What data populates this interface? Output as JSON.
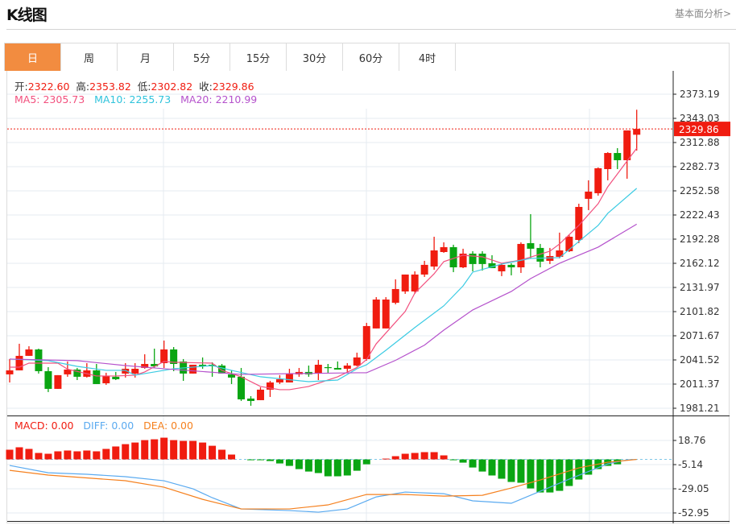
{
  "header": {
    "title": "K线图",
    "more_link": "基本面分析>"
  },
  "tabs": [
    {
      "label": "日",
      "active": true
    },
    {
      "label": "周",
      "active": false
    },
    {
      "label": "月",
      "active": false
    },
    {
      "label": "5分",
      "active": false
    },
    {
      "label": "15分",
      "active": false
    },
    {
      "label": "30分",
      "active": false
    },
    {
      "label": "60分",
      "active": false
    },
    {
      "label": "4时",
      "active": false
    }
  ],
  "ohlc_legend": {
    "open_label": "开:",
    "open": "2322.60",
    "high_label": "高:",
    "high": "2353.82",
    "low_label": "低:",
    "low": "2302.82",
    "close_label": "收:",
    "close": "2329.86"
  },
  "ma_legend": {
    "ma5": "MA5: 2305.73",
    "ma10": "MA10: 2255.73",
    "ma20": "MA20: 2210.99"
  },
  "macd_legend": {
    "macd": "MACD: 0.00",
    "diff": "DIFF: 0.00",
    "dea": "DEA: 0.00"
  },
  "colors": {
    "up": "#f01c10",
    "down": "#0aa512",
    "ma5": "#f2507e",
    "ma10": "#3ccbe3",
    "ma20": "#b552cc",
    "diff": "#5aaaf0",
    "dea": "#f5801e",
    "accent_tab": "#f28c40"
  },
  "chart_data": [
    {
      "type": "candlestick",
      "title": "",
      "ylim": [
        1981.21,
        2373.19
      ],
      "y_ticks": [
        "2373.19",
        "2343.03",
        "2312.88",
        "2282.73",
        "2252.58",
        "2222.43",
        "2192.28",
        "2162.12",
        "2131.97",
        "2101.82",
        "2071.67",
        "2041.52",
        "2011.37",
        "1981.21"
      ],
      "last_price_label": "2329.86",
      "last_price": 2329.86,
      "grid": true,
      "candles_ohlc": [
        [
          2023.5,
          2042.6,
          2013.4,
          2028.5
        ],
        [
          2028.5,
          2061.7,
          2028.5,
          2046.6
        ],
        [
          2046.6,
          2058.6,
          2046.6,
          2054.6
        ],
        [
          2054.6,
          2055.6,
          2024.5,
          2027.5
        ],
        [
          2027.5,
          2032.5,
          2001.4,
          2005.4
        ],
        [
          2005.4,
          2022.5,
          2005.4,
          2022.5
        ],
        [
          2023.5,
          2039.6,
          2020.5,
          2029.5
        ],
        [
          2029.5,
          2031.5,
          2016.4,
          2020.5
        ],
        [
          2020.5,
          2037.5,
          2019.5,
          2028.5
        ],
        [
          2028.5,
          2036.5,
          2011.4,
          2011.4
        ],
        [
          2012.4,
          2025.5,
          2010.4,
          2021.5
        ],
        [
          2020.5,
          2026.5,
          2016.4,
          2017.4
        ],
        [
          2024.5,
          2037.5,
          2019.5,
          2030.5
        ],
        [
          2024.5,
          2037.5,
          2019.5,
          2030.5
        ],
        [
          2031.5,
          2048.6,
          2030.5,
          2036.5
        ],
        [
          2036.5,
          2055.6,
          2031.5,
          2033.5
        ],
        [
          2037.5,
          2065.7,
          2031.5,
          2054.6
        ],
        [
          2054.6,
          2057.6,
          2027.5,
          2036.5
        ],
        [
          2039.6,
          2042.6,
          2015.4,
          2024.5
        ],
        [
          2024.5,
          2035.5,
          2024.5,
          2035.5
        ],
        [
          2035.5,
          2044.6,
          2030.5,
          2033.5
        ],
        [
          2035.5,
          2038.6,
          2020.5,
          2033.5
        ],
        [
          2034.5,
          2036.5,
          2024.5,
          2024.5
        ],
        [
          2023.5,
          2028.5,
          2011.4,
          2019.5
        ],
        [
          2020.5,
          2031.5,
          1990.3,
          1992.3
        ],
        [
          1993.3,
          1996.3,
          1984.3,
          1990.3
        ],
        [
          1991.3,
          2007.4,
          1991.3,
          2004.4
        ],
        [
          2004.4,
          2015.4,
          1995.3,
          2013.4
        ],
        [
          2013.4,
          2022.5,
          2011.4,
          2017.4
        ],
        [
          2013.4,
          2030.5,
          2013.4,
          2024.5
        ],
        [
          2023.5,
          2031.5,
          2020.5,
          2026.5
        ],
        [
          2026.5,
          2034.5,
          2020.5,
          2023.5
        ],
        [
          2024.5,
          2041.6,
          2016.4,
          2035.5
        ],
        [
          2032.5,
          2036.5,
          2025.5,
          2031.5
        ],
        [
          2031.5,
          2039.6,
          2029.5,
          2029.5
        ],
        [
          2030.5,
          2037.5,
          2025.5,
          2034.5
        ],
        [
          2034.5,
          2050.6,
          2033.5,
          2044.6
        ],
        [
          2042.6,
          2087.8,
          2040.6,
          2083.8
        ],
        [
          2080.8,
          2119.9,
          2080.8,
          2116.9
        ],
        [
          2080.8,
          2119.9,
          2080.8,
          2116.9
        ],
        [
          2112.9,
          2142.1,
          2110.9,
          2130.0
        ],
        [
          2127.0,
          2148.1,
          2124.0,
          2148.1
        ],
        [
          2127.0,
          2152.1,
          2124.0,
          2148.1
        ],
        [
          2148.1,
          2165.2,
          2145.1,
          2160.2
        ],
        [
          2158.1,
          2195.3,
          2154.1,
          2178.2
        ],
        [
          2176.2,
          2188.3,
          2175.2,
          2182.3
        ],
        [
          2182.3,
          2185.3,
          2151.1,
          2157.1
        ],
        [
          2157.1,
          2180.3,
          2156.1,
          2174.2
        ],
        [
          2174.2,
          2177.2,
          2152.1,
          2161.2
        ],
        [
          2174.2,
          2177.2,
          2153.1,
          2161.2
        ],
        [
          2162.2,
          2172.2,
          2156.1,
          2156.1
        ],
        [
          2152.1,
          2162.2,
          2146.1,
          2160.2
        ],
        [
          2160.2,
          2162.2,
          2147.1,
          2157.1
        ],
        [
          2157.1,
          2188.3,
          2150.1,
          2186.3
        ],
        [
          2187.3,
          2223.5,
          2168.2,
          2180.3
        ],
        [
          2181.3,
          2186.3,
          2157.1,
          2164.2
        ],
        [
          2165.2,
          2181.3,
          2161.2,
          2171.2
        ],
        [
          2170.2,
          2200.4,
          2168.2,
          2178.2
        ],
        [
          2177.2,
          2197.3,
          2176.2,
          2195.3
        ],
        [
          2191.3,
          2236.5,
          2187.3,
          2232.5
        ],
        [
          2242.6,
          2265.7,
          2228.5,
          2251.6
        ],
        [
          2249.6,
          2281.8,
          2246.6,
          2280.8
        ],
        [
          2279.7,
          2300.9,
          2265.7,
          2299.8
        ],
        [
          2299.8,
          2305.9,
          2279.7,
          2290.8
        ],
        [
          2290.8,
          2328.0,
          2267.7,
          2328.0
        ],
        [
          2322.6,
          2353.82,
          2302.82,
          2329.86
        ]
      ],
      "series": [
        {
          "name": "MA5",
          "points": [
            [
              0,
              2032.5
            ],
            [
              1,
              2032.5
            ],
            [
              2,
              2037.5
            ],
            [
              5,
              2037.5
            ],
            [
              6,
              2030
            ],
            [
              9,
              2021.5
            ],
            [
              11,
              2021.5
            ],
            [
              13,
              2022.5
            ],
            [
              14,
              2026.5
            ],
            [
              16,
              2039.6
            ],
            [
              17,
              2038.6
            ],
            [
              21,
              2037.5
            ],
            [
              22,
              2028.5
            ],
            [
              24,
              2020.5
            ],
            [
              26,
              2008.4
            ],
            [
              28,
              2004.4
            ],
            [
              29,
              2004.4
            ],
            [
              31,
              2008.4
            ],
            [
              34,
              2020.5
            ],
            [
              36,
              2032
            ],
            [
              37,
              2042
            ],
            [
              38,
              2061.7
            ],
            [
              41,
              2102
            ],
            [
              42,
              2125
            ],
            [
              44,
              2149.1
            ],
            [
              45,
              2164.2
            ],
            [
              47,
              2172.2
            ],
            [
              49,
              2170.2
            ],
            [
              50,
              2166.2
            ],
            [
              51,
              2162.2
            ],
            [
              53,
              2166.2
            ],
            [
              56,
              2177.2
            ],
            [
              57,
              2186.3
            ],
            [
              59,
              2209.4
            ],
            [
              61,
              2236.5
            ],
            [
              62,
              2257.6
            ],
            [
              64,
              2289.8
            ],
            [
              65,
              2305.73
            ]
          ]
        },
        {
          "name": "MA10",
          "points": [
            [
              0,
              2042.6
            ],
            [
              4,
              2040.6
            ],
            [
              7,
              2033.5
            ],
            [
              10,
              2028.5
            ],
            [
              12,
              2028.5
            ],
            [
              13,
              2022.5
            ],
            [
              15,
              2026.5
            ],
            [
              17,
              2030.5
            ],
            [
              21,
              2034.5
            ],
            [
              23,
              2028.5
            ],
            [
              26,
              2020.5
            ],
            [
              31,
              2014.4
            ],
            [
              34,
              2016.4
            ],
            [
              36,
              2030.5
            ],
            [
              37,
              2035.5
            ],
            [
              39,
              2053.6
            ],
            [
              42,
              2082
            ],
            [
              45,
              2109
            ],
            [
              47,
              2134
            ],
            [
              48,
              2151.1
            ],
            [
              51,
              2161.2
            ],
            [
              54,
              2168.2
            ],
            [
              57,
              2169.2
            ],
            [
              59,
              2189.3
            ],
            [
              61,
              2209.4
            ],
            [
              62,
              2224.5
            ],
            [
              65,
              2255.73
            ]
          ]
        },
        {
          "name": "MA20",
          "points": [
            [
              0,
              2042.6
            ],
            [
              7,
              2040.6
            ],
            [
              12,
              2034.5
            ],
            [
              16,
              2030.5
            ],
            [
              24,
              2023.5
            ],
            [
              36,
              2025.5
            ],
            [
              37,
              2025.5
            ],
            [
              40,
              2041
            ],
            [
              43,
              2060
            ],
            [
              45,
              2078.7
            ],
            [
              48,
              2103.9
            ],
            [
              52,
              2127
            ],
            [
              54,
              2143
            ],
            [
              57,
              2162.2
            ],
            [
              61,
              2182.3
            ],
            [
              65,
              2210.99
            ]
          ]
        }
      ]
    },
    {
      "type": "bar",
      "title": "",
      "ylim": [
        -62.5,
        31.4
      ],
      "y_ticks": [
        "18.76",
        "-5.14",
        "-29.05",
        "-52.95"
      ],
      "grid": true,
      "macd_hist": [
        9.6,
        12.0,
        10.4,
        6.4,
        5.6,
        8.0,
        8.8,
        8.0,
        8.8,
        8.0,
        10.4,
        12.8,
        15.1,
        16.7,
        19.1,
        19.9,
        21.5,
        19.1,
        18.3,
        18.3,
        16.7,
        13.5,
        9.6,
        4.8,
        0,
        -0.8,
        -0.8,
        -1.6,
        -4.0,
        -6.4,
        -9.6,
        -12.0,
        -13.5,
        -16.7,
        -16.7,
        -15.9,
        -11.2,
        -4.8,
        0,
        0.8,
        3.2,
        5.6,
        6.4,
        7.2,
        7.2,
        4.0,
        -0.8,
        -3.2,
        -8.0,
        -12.0,
        -15.9,
        -19.1,
        -22.3,
        -23.1,
        -28.7,
        -32.7,
        -32.7,
        -31.1,
        -26.3,
        -19.9,
        -15.1,
        -9.6,
        -6.4,
        -4.8,
        0,
        0
      ],
      "series": [
        {
          "name": "DIFF",
          "points": [
            [
              0,
              -6.0
            ],
            [
              4,
              -13.2
            ],
            [
              8,
              -14.7
            ],
            [
              12,
              -17.1
            ],
            [
              16,
              -21.1
            ],
            [
              19,
              -29.1
            ],
            [
              21,
              -37.9
            ],
            [
              24,
              -49.0
            ],
            [
              29,
              -50.6
            ],
            [
              32,
              -52.2
            ],
            [
              35,
              -49.0
            ],
            [
              38,
              -37.1
            ],
            [
              41,
              -32.3
            ],
            [
              45,
              -33.9
            ],
            [
              48,
              -41.0
            ],
            [
              52,
              -43.4
            ],
            [
              55,
              -31.5
            ],
            [
              58,
              -19.5
            ],
            [
              62,
              -4.4
            ],
            [
              64,
              -0.4
            ],
            [
              65,
              0
            ]
          ]
        },
        {
          "name": "DEA",
          "points": [
            [
              0,
              -10.8
            ],
            [
              4,
              -15.5
            ],
            [
              12,
              -21.1
            ],
            [
              16,
              -27.5
            ],
            [
              20,
              -39.5
            ],
            [
              24,
              -49.0
            ],
            [
              29,
              -49.0
            ],
            [
              33,
              -45.0
            ],
            [
              37,
              -34.7
            ],
            [
              41,
              -34.7
            ],
            [
              45,
              -36.3
            ],
            [
              49,
              -35.5
            ],
            [
              52,
              -28.3
            ],
            [
              55,
              -20.3
            ],
            [
              59,
              -8.4
            ],
            [
              62,
              -2.8
            ],
            [
              65,
              0
            ]
          ]
        }
      ]
    }
  ]
}
